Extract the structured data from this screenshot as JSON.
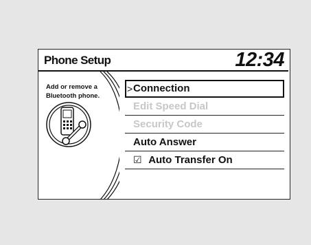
{
  "header": {
    "title": "Phone Setup",
    "clock": "12:34"
  },
  "left_panel": {
    "hint": "Add or remove a Bluetooth phone.",
    "icon": "phone-wrench-icon"
  },
  "menu": {
    "items": [
      {
        "label": "Connection",
        "state": "selected"
      },
      {
        "label": "Edit Speed Dial",
        "state": "disabled"
      },
      {
        "label": "Security Code",
        "state": "disabled"
      },
      {
        "label": "Auto Answer",
        "state": "enabled"
      },
      {
        "label": "Auto Transfer On",
        "state": "enabled",
        "checked": true
      }
    ],
    "cursor_glyph": ">",
    "check_glyph": "☑"
  },
  "colors": {
    "background": "#e6e6e6",
    "screen": "#ffffff",
    "text": "#111111",
    "disabled_text": "#c7c7c7"
  }
}
